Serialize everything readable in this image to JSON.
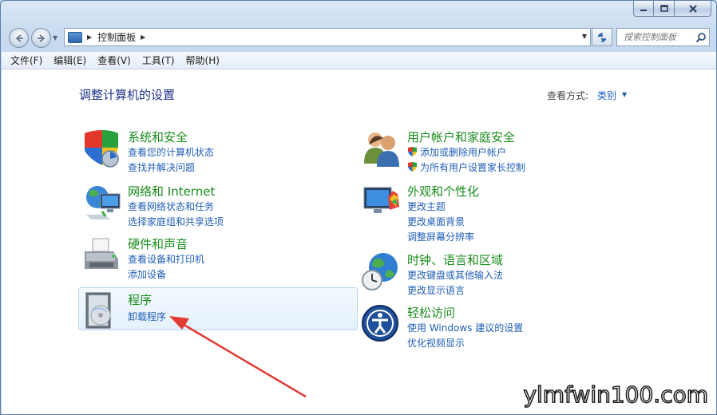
{
  "navbar": {
    "address_segment": "控制面板",
    "search_placeholder": "搜索控制面板"
  },
  "menubar": {
    "items": [
      "文件(F)",
      "编辑(E)",
      "查看(V)",
      "工具(T)",
      "帮助(H)"
    ]
  },
  "content": {
    "title": "调整计算机的设置",
    "view_by_label": "查看方式:",
    "view_by_value": "类别"
  },
  "categories": [
    {
      "title": "系统和安全",
      "icon": "shield-icon",
      "links": [
        "查看您的计算机状态",
        "查找并解决问题"
      ]
    },
    {
      "title": "网络和 Internet",
      "icon": "network-icon",
      "links": [
        "查看网络状态和任务",
        "选择家庭组和共享选项"
      ]
    },
    {
      "title": "硬件和声音",
      "icon": "printer-icon",
      "links": [
        "查看设备和打印机",
        "添加设备"
      ]
    },
    {
      "title": "程序",
      "icon": "programs-icon",
      "links": [
        "卸载程序"
      ]
    },
    {
      "title": "用户帐户和家庭安全",
      "icon": "users-icon",
      "links": [
        "添加或删除用户帐户",
        "为所有用户设置家长控制"
      ]
    },
    {
      "title": "外观和个性化",
      "icon": "monitor-icon",
      "links": [
        "更改主题",
        "更改桌面背景",
        "调整屏幕分辨率"
      ]
    },
    {
      "title": "时钟、语言和区域",
      "icon": "globe-clock-icon",
      "links": [
        "更改键盘或其他输入法",
        "更改显示语言"
      ]
    },
    {
      "title": "轻松访问",
      "icon": "ease-of-access-icon",
      "links": [
        "使用 Windows 建议的设置",
        "优化视频显示"
      ]
    }
  ],
  "watermark": "ylmfwin100.com",
  "colors": {
    "category_title": "#1a8c1d",
    "link": "#1f5eb7",
    "page_title": "#1e3287",
    "annotation_arrow": "#e33a32"
  }
}
